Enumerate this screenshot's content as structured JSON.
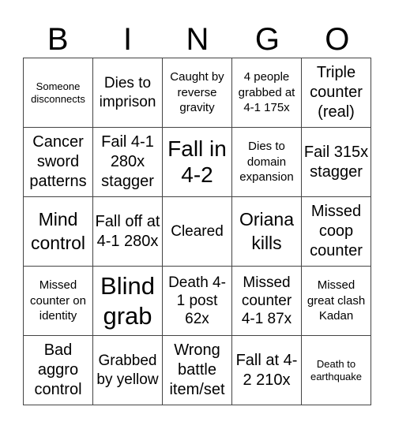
{
  "title_letters": [
    "B",
    "I",
    "N",
    "G",
    "O"
  ],
  "cells": [
    {
      "text": "Someone disconnects"
    },
    {
      "text": "Dies to imprison"
    },
    {
      "text": "Caught by reverse gravity"
    },
    {
      "text": "4 people grabbed at 4-1 175x"
    },
    {
      "text": "Triple counter (real)"
    },
    {
      "text": "Cancer sword patterns"
    },
    {
      "text": "Fail 4-1 280x stagger"
    },
    {
      "text": "Fall in 4-2"
    },
    {
      "text": "Dies to domain expansion"
    },
    {
      "text": "Fail 315x stagger"
    },
    {
      "text": "Mind control"
    },
    {
      "text": "Fall off at 4-1 280x"
    },
    {
      "text": "Cleared"
    },
    {
      "text": "Oriana kills"
    },
    {
      "text": "Missed coop counter"
    },
    {
      "text": "Missed counter on identity"
    },
    {
      "text": "Blind grab"
    },
    {
      "text": "Death 4-1 post 62x"
    },
    {
      "text": "Missed counter 4-1 87x"
    },
    {
      "text": "Missed great clash Kadan"
    },
    {
      "text": "Bad aggro control"
    },
    {
      "text": "Grabbed by yellow"
    },
    {
      "text": "Wrong battle item/set"
    },
    {
      "text": "Fall at 4-2 210x"
    },
    {
      "text": "Death to earthquake"
    }
  ]
}
